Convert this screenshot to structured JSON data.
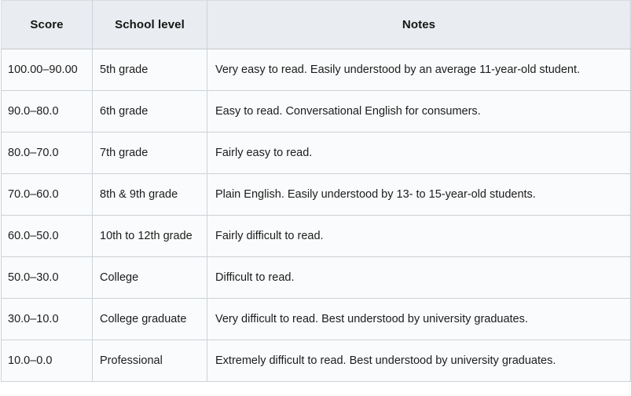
{
  "table": {
    "headers": [
      {
        "label": "Score",
        "name": "score"
      },
      {
        "label": "School level",
        "name": "school-level"
      },
      {
        "label": "Notes",
        "name": "notes"
      }
    ],
    "rows": [
      {
        "score": "100.00–90.00",
        "school_level": "5th grade",
        "notes": "Very easy to read. Easily understood by an average 11-year-old student."
      },
      {
        "score": "90.0–80.0",
        "school_level": "6th grade",
        "notes": "Easy to read. Conversational English for consumers."
      },
      {
        "score": "80.0–70.0",
        "school_level": "7th grade",
        "notes": "Fairly easy to read."
      },
      {
        "score": "70.0–60.0",
        "school_level": "8th & 9th grade",
        "notes": "Plain English. Easily understood by 13- to 15-year-old students."
      },
      {
        "score": "60.0–50.0",
        "school_level": "10th to 12th grade",
        "notes": "Fairly difficult to read."
      },
      {
        "score": "50.0–30.0",
        "school_level": "College",
        "notes": "Difficult to read."
      },
      {
        "score": "30.0–10.0",
        "school_level": "College graduate",
        "notes": "Very difficult to read. Best understood by university graduates."
      },
      {
        "score": "10.0–0.0",
        "school_level": "Professional",
        "notes": "Extremely difficult to read. Best understood by university graduates."
      }
    ]
  },
  "colors": {
    "header_background": "#e9ecf0",
    "row_background": "#fafbfc",
    "border": "#ccd2d8",
    "text": "#1c1c1c"
  }
}
